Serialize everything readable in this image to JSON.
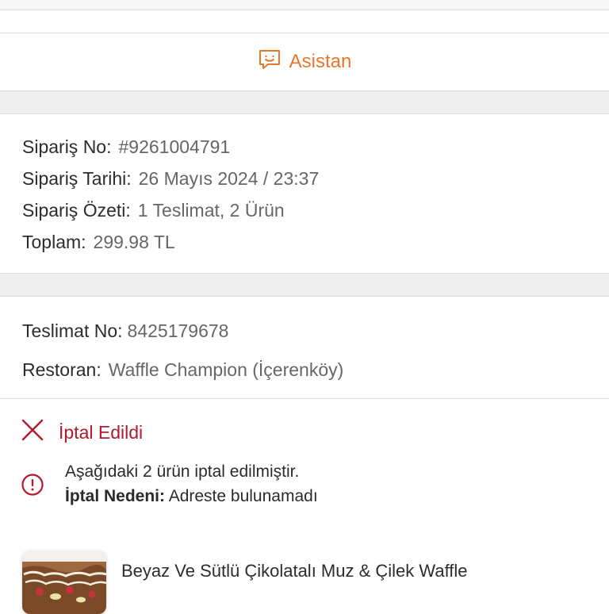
{
  "assistant": {
    "label": "Asistan",
    "icon": "chat-bubble-icon",
    "color": "#e8772a"
  },
  "order": {
    "no_label": "Sipariş No:",
    "no_value": "#9261004791",
    "date_label": "Sipariş Tarihi:",
    "date_value": "26 Mayıs 2024 / 23:37",
    "summary_label": "Sipariş Özeti:",
    "summary_delivery": "1 Teslimat",
    "summary_sep": ", ",
    "summary_items": "2 Ürün",
    "total_label": "Toplam:",
    "total_value": "299.98 TL"
  },
  "delivery": {
    "no_label": "Teslimat No:",
    "no_value": "8425179678",
    "restaurant_label": "Restoran:",
    "restaurant_value": "Waffle Champion (İçerenköy)"
  },
  "status": {
    "label": "İptal Edildi",
    "color": "#b3192e",
    "icon": "close-x-icon"
  },
  "notice": {
    "line1": "Aşağıdaki 2 ürün iptal edilmiştir.",
    "reason_label": "İptal Nedeni:",
    "reason_value": "Adreste bulunamadı",
    "icon": "info-circle-icon"
  },
  "product": {
    "name": "Beyaz Ve Sütlü Çikolatalı Muz & Çilek Waffle"
  }
}
